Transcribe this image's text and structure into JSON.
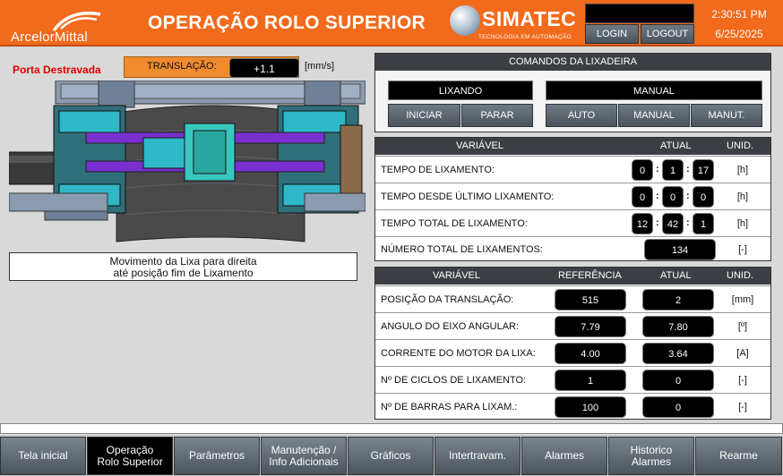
{
  "header": {
    "logo_text": "ArcelorMittal",
    "title": "OPERAÇÃO ROLO SUPERIOR",
    "brand_name": "SIMATEC",
    "brand_tagline": "TECNOLOGIA EM AUTOMAÇÃO",
    "login_label": "LOGIN",
    "logout_label": "LOGOUT",
    "user": "",
    "time": "2:30:51 PM",
    "date": "6/25/2025",
    "accent_color": "#f26a1b"
  },
  "left": {
    "porta_status": "Porta Destravada",
    "translacao_label": "TRANSLAÇÃO:",
    "translacao_value": "+1.1",
    "translacao_unit": "[mm/s]",
    "message_line1": "Movimento da Lixa para direita",
    "message_line2": "até posição fim de Lixamento"
  },
  "comandos": {
    "title": "COMANDOS DA LIXADEIRA",
    "status_left": "LIXANDO",
    "status_right": "MANUAL",
    "buttons_left": [
      "INICIAR",
      "PARAR"
    ],
    "buttons_right": [
      "AUTO",
      "MANUAL",
      "MANUT."
    ]
  },
  "tempos": {
    "headers": {
      "variavel": "VARIÁVEL",
      "atual": "ATUAL",
      "unid": "UNID."
    },
    "rows": [
      {
        "label": "TEMPO DE LIXAMENTO:",
        "h": "0",
        "m": "1",
        "s": "17",
        "unit": "[h]"
      },
      {
        "label": "TEMPO DESDE ÚLTIMO LIXAMENTO:",
        "h": "0",
        "m": "0",
        "s": "0",
        "unit": "[h]"
      },
      {
        "label": "TEMPO TOTAL DE LIXAMENTO:",
        "h": "12",
        "m": "42",
        "s": "1",
        "unit": "[h]"
      }
    ],
    "total": {
      "label": "NÚMERO TOTAL DE LIXAMENTOS:",
      "value": "134",
      "unit": "[-]"
    }
  },
  "variaveis": {
    "headers": {
      "variavel": "VARIÁVEL",
      "referencia": "REFERÊNCIA",
      "atual": "ATUAL",
      "unid": "UNID."
    },
    "rows": [
      {
        "label": "POSIÇÃO DA TRANSLAÇÃO:",
        "ref": "515",
        "atual": "2",
        "unit": "[mm]"
      },
      {
        "label": "ANGULO DO EIXO ANGULAR:",
        "ref": "7.79",
        "atual": "7.80",
        "unit": "[º]"
      },
      {
        "label": "CORRENTE DO MOTOR DA LIXA:",
        "ref": "4.00",
        "atual": "3.64",
        "unit": "[A]"
      },
      {
        "label": "Nº DE CICLOS DE LIXAMENTO:",
        "ref": "1",
        "atual": "0",
        "unit": "[-]"
      },
      {
        "label": "Nº DE BARRAS PARA LIXAM.:",
        "ref": "100",
        "atual": "0",
        "unit": "[-]"
      }
    ]
  },
  "nav": {
    "items": [
      {
        "line1": "Tela inicial",
        "line2": ""
      },
      {
        "line1": "Operação",
        "line2": "Rolo Superior"
      },
      {
        "line1": "Parâmetros",
        "line2": ""
      },
      {
        "line1": "Manutenção /",
        "line2": "Info Adicionais"
      },
      {
        "line1": "Gráficos",
        "line2": ""
      },
      {
        "line1": "Intertravam.",
        "line2": ""
      },
      {
        "line1": "Alarmes",
        "line2": ""
      },
      {
        "line1": "Historico",
        "line2": "Alarmes"
      },
      {
        "line1": "Rearme",
        "line2": ""
      }
    ],
    "active_index": 1
  }
}
